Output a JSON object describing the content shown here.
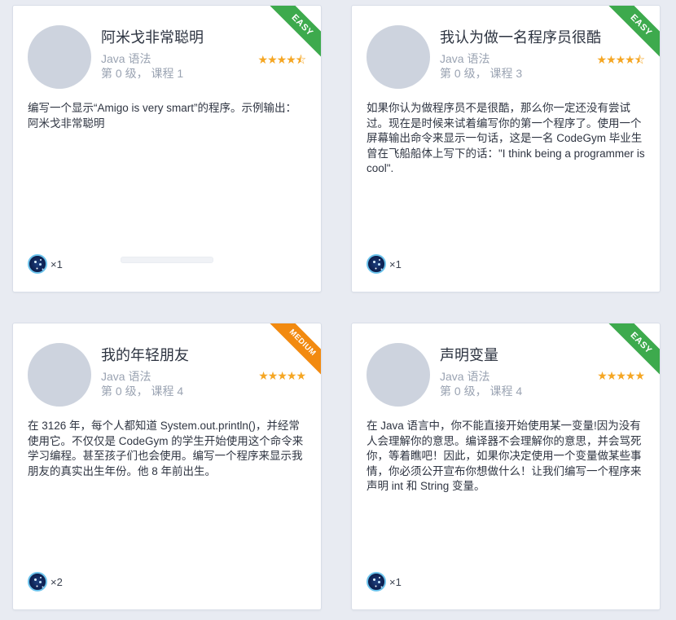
{
  "cards": [
    {
      "title": "阿米戈非常聪明",
      "category": "Java 语法",
      "level_lesson": "第 0 级， 课程 1",
      "stars": "★★★★⯪",
      "rating": 4.5,
      "difficulty": "EASY",
      "description": "编写一个显示“Amigo is very smart”的程序。示例输出：阿米戈非常聪明",
      "reward_count": "×1",
      "progress": 0
    },
    {
      "title": "我认为做一名程序员很酷",
      "category": "Java 语法",
      "level_lesson": "第 0 级， 课程 3",
      "stars": "★★★★⯪",
      "rating": 4.5,
      "difficulty": "EASY",
      "description": "如果你认为做程序员不是很酷，那么你一定还没有尝试过。现在是时候来试着编写你的第一个程序了。使用一个屏幕输出命令来显示一句话，这是一名 CodeGym 毕业生曾在飞船船体上写下的话：\"I think being a programmer is cool\".",
      "reward_count": "×1"
    },
    {
      "title": "我的年轻朋友",
      "category": "Java 语法",
      "level_lesson": "第 0 级， 课程 4",
      "stars": "★★★★★",
      "rating": 5,
      "difficulty": "MEDIUM",
      "description": "在 3126 年，每个人都知道 System.out.println()，并经常使用它。不仅仅是 CodeGym 的学生开始使用这个命令来学习编程。甚至孩子们也会使用。编写一个程序来显示我朋友的真实出生年份。他 8 年前出生。",
      "reward_count": "×2"
    },
    {
      "title": "声明变量",
      "category": "Java 语法",
      "level_lesson": "第 0 级， 课程 4",
      "stars": "★★★★★",
      "rating": 5,
      "difficulty": "EASY",
      "description": "在 Java 语言中，你不能直接开始使用某一变量!因为没有人会理解你的意思。编译器不会理解你的意思，并会骂死你，等着瞧吧！因此，如果你决定使用一个变量做某些事情，你必须公开宣布你想做什么！让我们编写一个程序来声明 int 和 String 变量。",
      "reward_count": "×1"
    }
  ],
  "colors": {
    "star": "#f5a623",
    "easy_ribbon": "#3daa4d",
    "medium_ribbon": "#f28a10",
    "background": "#e8ebf2"
  },
  "icons": {
    "reward": "dark-matter-icon"
  }
}
